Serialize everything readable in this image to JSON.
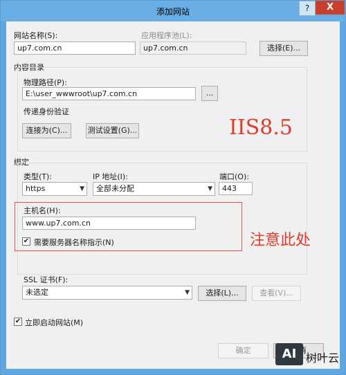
{
  "window": {
    "title": "添加网站",
    "help_label": "?",
    "close_label": "X"
  },
  "site": {
    "name_label": "网站名称(S):",
    "name_value": "up7.com.cn",
    "apppool_label": "应用程序池(L):",
    "apppool_value": "up7.com.cn",
    "select_label": "选择(E)..."
  },
  "content": {
    "group_label": "内容目录",
    "path_label": "物理路径(P):",
    "path_value": "E:\\user_wwwroot\\up7.com.cn",
    "browse_label": "...",
    "auth_label": "传递身份验证",
    "connect_label": "连接为(C)...",
    "test_label": "测试设置(G)..."
  },
  "binding": {
    "group_label": "绑定",
    "type_label": "类型(T):",
    "type_value": "https",
    "ip_label": "IP 地址(I):",
    "ip_value": "全部未分配",
    "port_label": "端口(O):",
    "port_value": "443",
    "host_label": "主机名(H):",
    "host_value": "www.up7.com.cn",
    "sni_label": "需要服务器名称指示(N)",
    "sni_checked": true
  },
  "ssl": {
    "label": "SSL 证书(F):",
    "value": "未选定",
    "select_label": "选择(L)...",
    "view_label": "查看(V)..."
  },
  "start": {
    "label": "立即启动网站(M)",
    "checked": true
  },
  "footer": {
    "ok_label": "确定",
    "cancel_label": "取消"
  },
  "annotations": {
    "version": "IIS8.5",
    "note": "注意此处"
  },
  "watermark": {
    "logo": "AI",
    "text": "树叶云"
  },
  "colors": {
    "title_bar": "#6aaee6",
    "close_button": "#c7402e",
    "annotation": "#e03a2c"
  }
}
